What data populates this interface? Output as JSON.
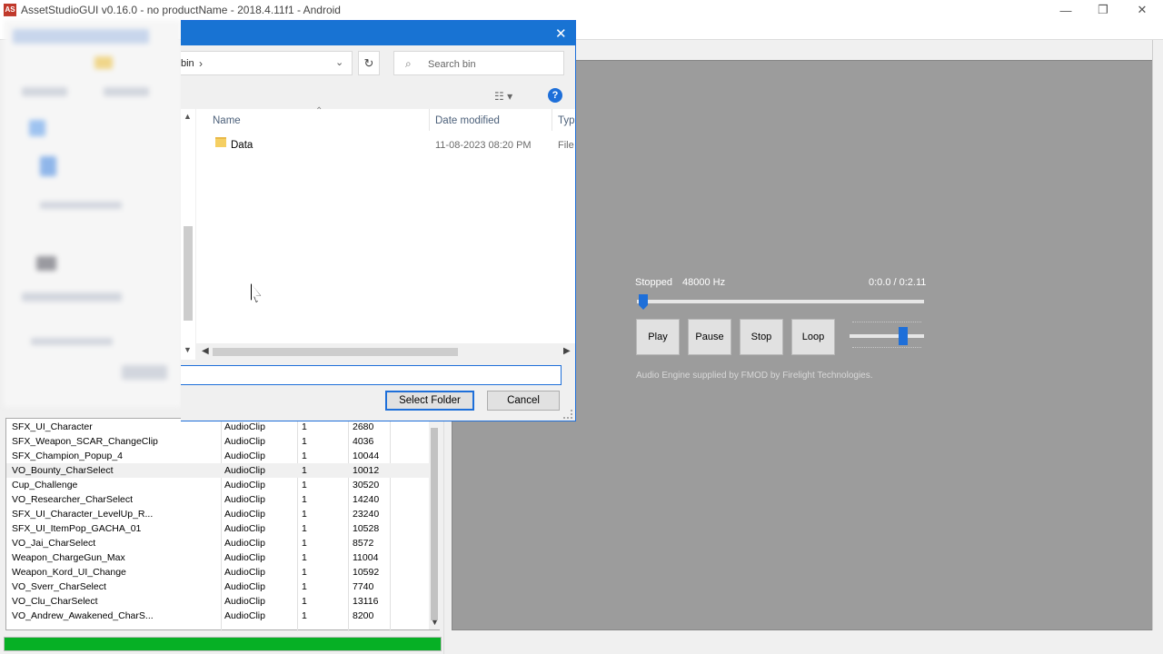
{
  "window": {
    "title": "AssetStudioGUI v0.16.0 - no productName - 2018.4.11f1 - Android",
    "app_icon": "AS",
    "minimize": "—",
    "maximize": "❐",
    "close": "✕"
  },
  "dialog": {
    "close": "✕",
    "address": {
      "path": "bin",
      "separator": "›",
      "dropdown": "⌄"
    },
    "refresh": "↻",
    "search_placeholder": "Search bin",
    "view_icon": "☷ ▾",
    "help": "?",
    "columns": {
      "name": "Name",
      "date": "Date modified",
      "type": "Type"
    },
    "files": [
      {
        "name": "Data",
        "date": "11-08-2023 08:20 PM",
        "type": "File"
      }
    ],
    "folder_value": "",
    "select_button": "Select Folder",
    "cancel_button": "Cancel"
  },
  "audio": {
    "status": "Stopped",
    "rate": "48000 Hz",
    "time": "0:0.0 / 0:2.11",
    "seek_fraction": 0.0,
    "volume_fraction": 0.8,
    "play": "Play",
    "pause": "Pause",
    "stop": "Stop",
    "loop": "Loop",
    "credit": "Audio Engine supplied by FMOD by Firelight Technologies."
  },
  "asset_list": {
    "rows": [
      {
        "name": "SFX_UI_Character",
        "type": "AudioClip",
        "count": "1",
        "size": "2680"
      },
      {
        "name": "SFX_Weapon_SCAR_ChangeClip",
        "type": "AudioClip",
        "count": "1",
        "size": "4036"
      },
      {
        "name": "SFX_Champion_Popup_4",
        "type": "AudioClip",
        "count": "1",
        "size": "10044"
      },
      {
        "name": "VO_Bounty_CharSelect",
        "type": "AudioClip",
        "count": "1",
        "size": "10012"
      },
      {
        "name": "Cup_Challenge",
        "type": "AudioClip",
        "count": "1",
        "size": "30520"
      },
      {
        "name": "VO_Researcher_CharSelect",
        "type": "AudioClip",
        "count": "1",
        "size": "14240"
      },
      {
        "name": "SFX_UI_Character_LevelUp_R...",
        "type": "AudioClip",
        "count": "1",
        "size": "23240"
      },
      {
        "name": "SFX_UI_ItemPop_GACHA_01",
        "type": "AudioClip",
        "count": "1",
        "size": "10528"
      },
      {
        "name": "VO_Jai_CharSelect",
        "type": "AudioClip",
        "count": "1",
        "size": "8572"
      },
      {
        "name": "Weapon_ChargeGun_Max",
        "type": "AudioClip",
        "count": "1",
        "size": "11004"
      },
      {
        "name": "Weapon_Kord_UI_Change",
        "type": "AudioClip",
        "count": "1",
        "size": "10592"
      },
      {
        "name": "VO_Sverr_CharSelect",
        "type": "AudioClip",
        "count": "1",
        "size": "7740"
      },
      {
        "name": "VO_Clu_CharSelect",
        "type": "AudioClip",
        "count": "1",
        "size": "13116"
      },
      {
        "name": "VO_Andrew_Awakened_CharS...",
        "type": "AudioClip",
        "count": "1",
        "size": "8200"
      }
    ],
    "progress_fraction": 1.0,
    "colors": {
      "progress": "#06b025",
      "accent": "#1e6fd9"
    }
  }
}
